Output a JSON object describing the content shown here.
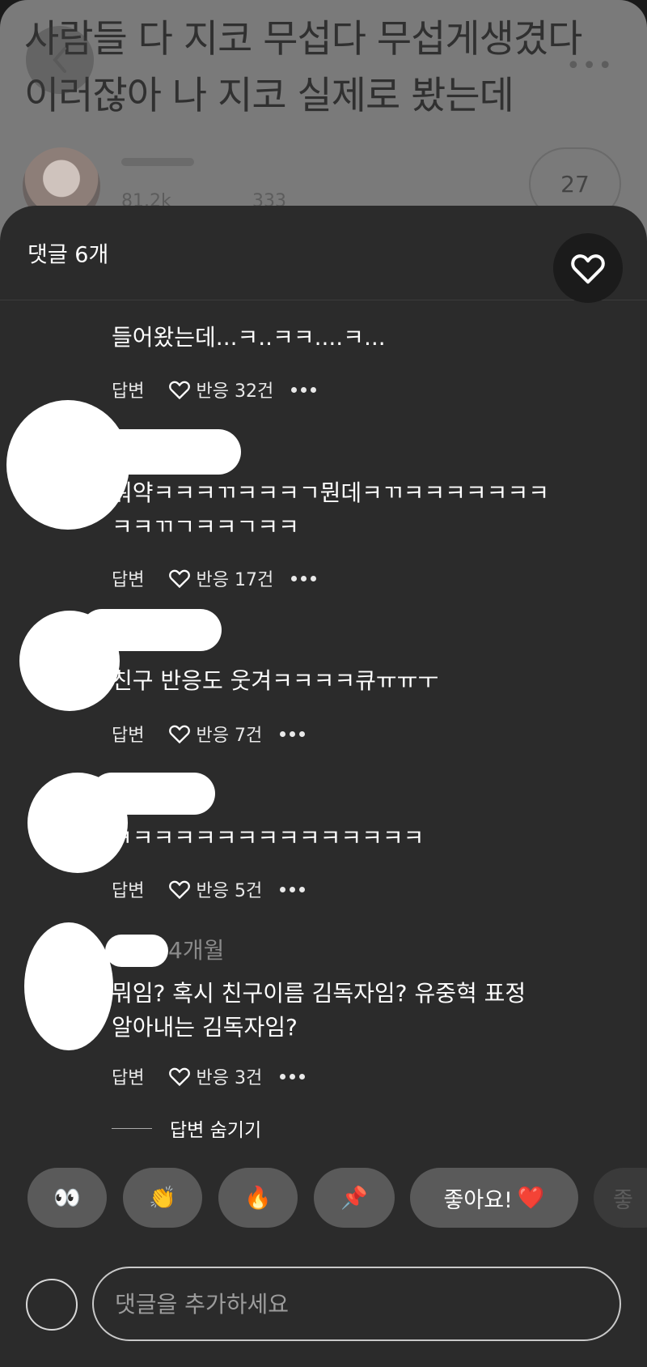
{
  "post": {
    "title": "사람들 다 지코 무섭다 무섭게생겼다 이러잖아 나 지코 실제로 봤는데",
    "stat_views": "81.2k",
    "stat_comments": "333",
    "count": "27"
  },
  "sheet": {
    "title": "댓글 6개"
  },
  "comments": [
    {
      "text": "들어왔는데...ㅋ..ㅋㅋ....ㅋ...",
      "reply": "답변",
      "reaction": "반응 32건"
    },
    {
      "text_line1": "뭐약ㅋㅋㅋㄲㅋㅋㅋㄱ뭔데ㅋㄲㅋㅋㅋㅋㅋㅋㅋ",
      "text_line2": "ㅋㅋㄲㄱㅋㅋㄱㅋㅋ",
      "reply": "답변",
      "reaction": "반응 17건"
    },
    {
      "text": "친구 반응도 웃겨ㅋㅋㅋㅋ큐ㅠㅠㅜ",
      "reply": "답변",
      "reaction": "반응 7건"
    },
    {
      "text": "ㅋㅋㅋㅋㅋㅋㅋㅋㅋㅋㅋㅋㅋㅋㅋ",
      "reply": "답변",
      "reaction": "반응 5건"
    },
    {
      "time": "4개월",
      "text_line1": "뭐임? 혹시 친구이름 김독자임? 유중혁 표정",
      "text_line2": "알아내는 김독자임?",
      "reply": "답변",
      "reaction": "반응 3건",
      "hide_replies": "답변 숨기기"
    }
  ],
  "reactions": [
    {
      "emoji": "👀"
    },
    {
      "emoji": "👏"
    },
    {
      "emoji": "🔥"
    },
    {
      "emoji": "📌"
    },
    {
      "label": "좋아요!",
      "emoji": "❤️"
    },
    {
      "label": "좋"
    }
  ],
  "composer": {
    "placeholder": "댓글을 추가하세요"
  },
  "colors": {
    "sheet_bg": "#2b2b2b",
    "chip_bg": "#5a5a5a",
    "heart_red": "#e02b3c"
  }
}
